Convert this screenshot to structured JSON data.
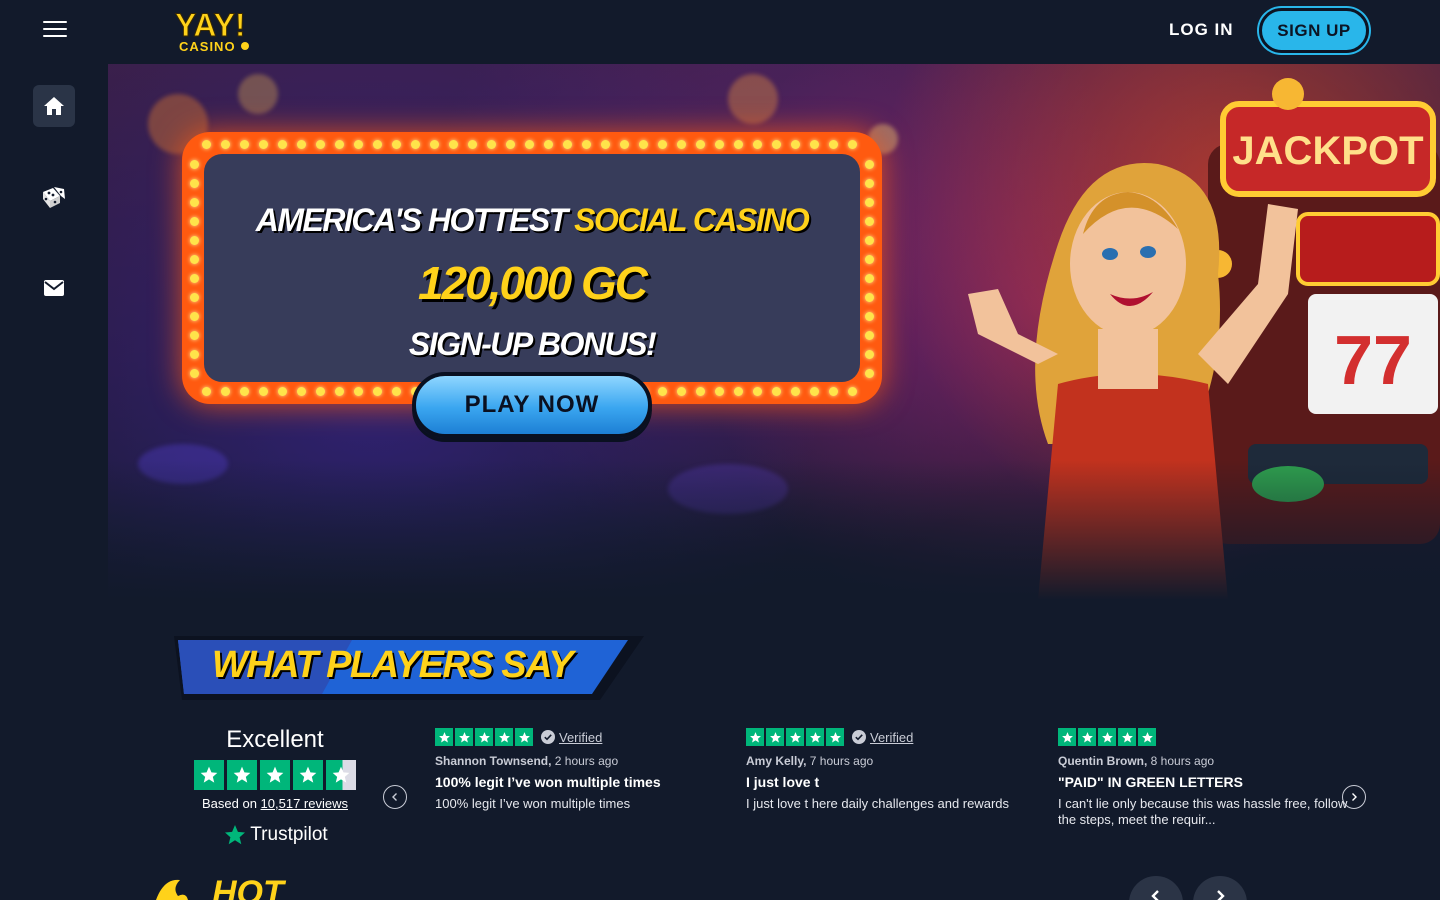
{
  "header": {
    "logo_text_main": "YAY!",
    "logo_text_sub": "CASINO",
    "login_label": "LOG IN",
    "signup_label": "SIGN UP"
  },
  "sidebar": {
    "items": [
      {
        "icon": "home-icon",
        "active": true
      },
      {
        "icon": "dice-icon",
        "active": false
      },
      {
        "icon": "mail-icon",
        "active": false
      }
    ]
  },
  "hero": {
    "line1_a": "AMERICA'S HOTTEST ",
    "line1_b": "SOCIAL CASINO",
    "amount": "120,000 GC",
    "line3": "SIGN-UP BONUS!",
    "cta_label": "PLAY NOW",
    "art_sign_text": "JACKPOT",
    "art_reel_text": "77"
  },
  "players": {
    "title": "WHAT PLAYERS SAY"
  },
  "trustpilot": {
    "rating_label": "Excellent",
    "based_prefix": "Based on ",
    "reviews_link": "10,517 reviews",
    "brand": "Trustpilot"
  },
  "reviews": [
    {
      "verified": "Verified",
      "author": "Shannon Townsend,",
      "time": " 2 hours ago",
      "title": "100% legit I’ve won multiple times",
      "body": "100% legit I’ve won multiple times"
    },
    {
      "verified": "Verified",
      "author": "Amy Kelly,",
      "time": " 7 hours ago",
      "title": "I just love t",
      "body": "I just love t here daily challenges and rewards"
    },
    {
      "author": "Quentin Brown,",
      "time": " 8 hours ago",
      "title": "\"PAID\" IN GREEN LETTERS",
      "body": "I can't lie only because this was hassle free, follow the steps, meet the requir..."
    }
  ],
  "hot_section": {
    "title": "HOT"
  },
  "colors": {
    "background": "#121a2b",
    "accent_blue": "#29b6ea",
    "accent_yellow": "#ffd21a",
    "marquee_orange": "#ff5a10",
    "trustpilot_green": "#00b67a"
  }
}
